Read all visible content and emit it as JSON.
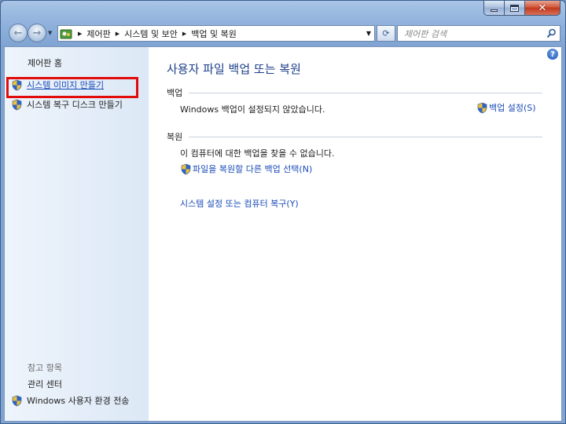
{
  "window": {
    "buttons": {
      "minimize": "minimize",
      "maximize": "maximize",
      "close": "✕"
    }
  },
  "navbar": {
    "breadcrumbs": [
      "제어판",
      "시스템 및 보안",
      "백업 및 복원"
    ],
    "search_placeholder": "제어판 검색"
  },
  "sidebar": {
    "home": "제어판 홈",
    "tasks": [
      {
        "label": "시스템 이미지 만들기",
        "highlighted": true
      },
      {
        "label": "시스템 복구 디스크 만들기",
        "highlighted": false
      }
    ],
    "see_also_header": "참고 항목",
    "see_also_links": [
      "관리 센터",
      "Windows 사용자 환경 전송"
    ]
  },
  "main": {
    "title": "사용자 파일 백업 또는 복원",
    "backup": {
      "header": "백업",
      "status": "Windows 백업이 설정되지 않았습니다.",
      "settings_link": "백업 설정(S)"
    },
    "restore": {
      "header": "복원",
      "status": "이 컴퓨터에 대한 백업을 찾을 수 없습니다.",
      "select_link": "파일을 복원할 다른 백업 선택(N)",
      "recover_link": "시스템 설정 또는 컴퓨터 복구(Y)"
    }
  },
  "colors": {
    "link": "#1a4bb8",
    "title": "#1d3f8a",
    "highlight_border": "#e10c0c",
    "sidebar_bg": "#e4edf8"
  }
}
